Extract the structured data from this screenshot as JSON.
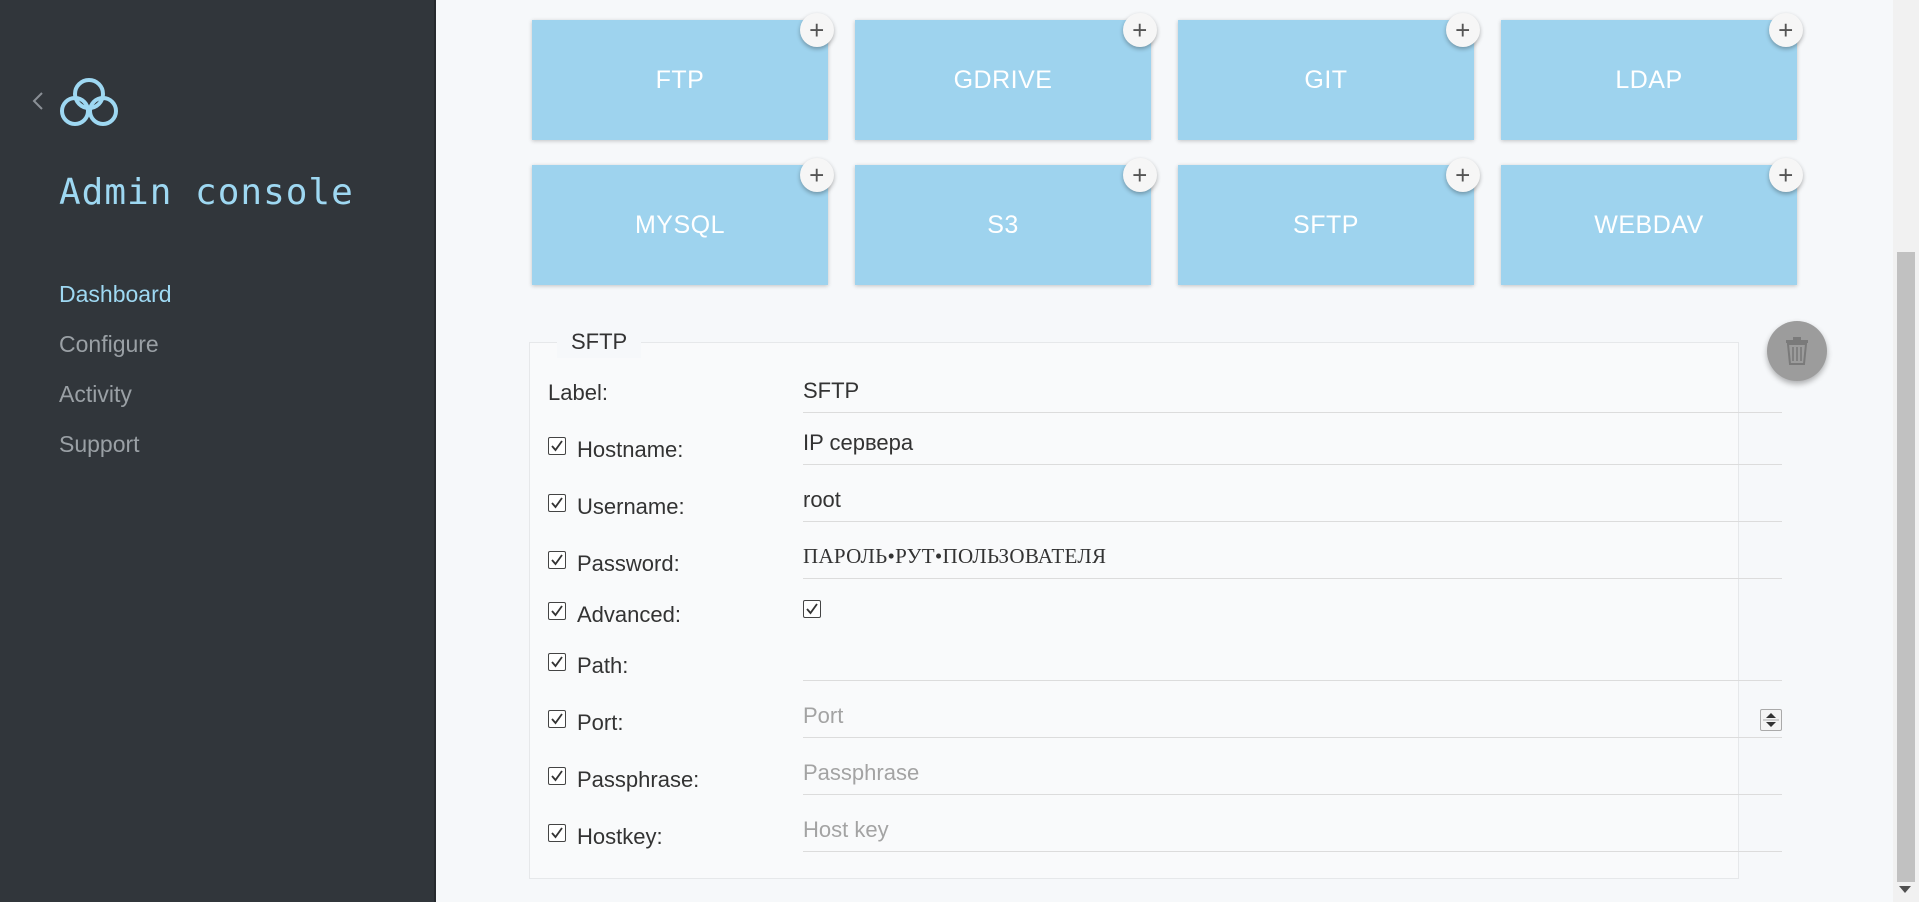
{
  "sidebar": {
    "title": "Admin console",
    "nav": [
      {
        "label": "Dashboard",
        "active": true
      },
      {
        "label": "Configure",
        "active": false
      },
      {
        "label": "Activity",
        "active": false
      },
      {
        "label": "Support",
        "active": false
      }
    ]
  },
  "backends": [
    {
      "label": "FTP",
      "add": "+"
    },
    {
      "label": "GDRIVE",
      "add": "+"
    },
    {
      "label": "GIT",
      "add": "+"
    },
    {
      "label": "LDAP",
      "add": "+"
    },
    {
      "label": "MYSQL",
      "add": "+"
    },
    {
      "label": "S3",
      "add": "+"
    },
    {
      "label": "SFTP",
      "add": "+"
    },
    {
      "label": "WEBDAV",
      "add": "+"
    }
  ],
  "form": {
    "legend": "SFTP",
    "label": {
      "label": "Label:",
      "value": "SFTP"
    },
    "hostname": {
      "label": "Hostname:",
      "value": "IP сервера",
      "checked": true
    },
    "username": {
      "label": "Username:",
      "value": "root",
      "checked": true
    },
    "password": {
      "label": "Password:",
      "value": "ПАРОЛЬ•РУТ•ПОЛЬЗОВАТЕЛЯ",
      "checked": true
    },
    "advanced": {
      "label": "Advanced:",
      "checked": true,
      "value_checked": true
    },
    "path": {
      "label": "Path:",
      "value": "",
      "checked": true
    },
    "port": {
      "label": "Port:",
      "placeholder": "Port",
      "checked": true
    },
    "passphrase": {
      "label": "Passphrase:",
      "placeholder": "Passphrase",
      "checked": true
    },
    "hostkey": {
      "label": "Hostkey:",
      "placeholder": "Host key",
      "checked": true
    }
  },
  "colors": {
    "sidebar_bg": "#31363b",
    "accent": "#9ed8f2",
    "tile_bg": "#9ed3ee",
    "delete_btn": "#9c9c9c"
  },
  "icons": {
    "back": "chevron-left-icon",
    "logo": "cloud-logo-icon",
    "add": "plus-icon",
    "delete": "trash-icon",
    "check": "checkmark-icon"
  }
}
